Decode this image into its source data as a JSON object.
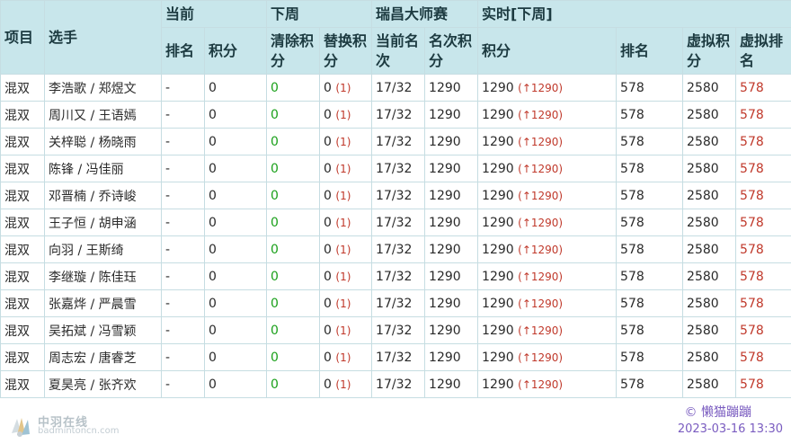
{
  "header": {
    "col_event": "项目",
    "col_players": "选手",
    "group_current": "当前",
    "group_next_week": "下周",
    "group_tournament": "瑞昌大师赛",
    "group_realtime": "实时[下周]",
    "sub_rank": "排名",
    "sub_points": "积分",
    "sub_clear_points": "清除积分",
    "sub_replace_points": "替换积分",
    "sub_current_round": "当前名次",
    "sub_round_points": "名次积分",
    "sub_rt_points": "积分",
    "sub_rt_rank": "排名",
    "sub_virtual_points": "虚拟积分",
    "sub_virtual_rank": "虚拟排名"
  },
  "rows": [
    {
      "event": "混双",
      "players": "李浩歌 / 郑煜文",
      "rank": "-",
      "points": "0",
      "clear": "0",
      "replace": "0",
      "replace_count": "(1)",
      "round": "17/32",
      "round_points": "1290",
      "rt_points": "1290",
      "rt_delta": "(↑1290)",
      "rt_rank": "578",
      "virtual_points": "2580",
      "virtual_rank": "578"
    },
    {
      "event": "混双",
      "players": "周川又 / 王语嫣",
      "rank": "-",
      "points": "0",
      "clear": "0",
      "replace": "0",
      "replace_count": "(1)",
      "round": "17/32",
      "round_points": "1290",
      "rt_points": "1290",
      "rt_delta": "(↑1290)",
      "rt_rank": "578",
      "virtual_points": "2580",
      "virtual_rank": "578"
    },
    {
      "event": "混双",
      "players": "关梓聪 / 杨晓雨",
      "rank": "-",
      "points": "0",
      "clear": "0",
      "replace": "0",
      "replace_count": "(1)",
      "round": "17/32",
      "round_points": "1290",
      "rt_points": "1290",
      "rt_delta": "(↑1290)",
      "rt_rank": "578",
      "virtual_points": "2580",
      "virtual_rank": "578"
    },
    {
      "event": "混双",
      "players": "陈锋 / 冯佳丽",
      "rank": "-",
      "points": "0",
      "clear": "0",
      "replace": "0",
      "replace_count": "(1)",
      "round": "17/32",
      "round_points": "1290",
      "rt_points": "1290",
      "rt_delta": "(↑1290)",
      "rt_rank": "578",
      "virtual_points": "2580",
      "virtual_rank": "578"
    },
    {
      "event": "混双",
      "players": "邓晋楠 / 乔诗峻",
      "rank": "-",
      "points": "0",
      "clear": "0",
      "replace": "0",
      "replace_count": "(1)",
      "round": "17/32",
      "round_points": "1290",
      "rt_points": "1290",
      "rt_delta": "(↑1290)",
      "rt_rank": "578",
      "virtual_points": "2580",
      "virtual_rank": "578"
    },
    {
      "event": "混双",
      "players": "王子恒 / 胡申涵",
      "rank": "-",
      "points": "0",
      "clear": "0",
      "replace": "0",
      "replace_count": "(1)",
      "round": "17/32",
      "round_points": "1290",
      "rt_points": "1290",
      "rt_delta": "(↑1290)",
      "rt_rank": "578",
      "virtual_points": "2580",
      "virtual_rank": "578"
    },
    {
      "event": "混双",
      "players": "向羽 / 王斯绮",
      "rank": "-",
      "points": "0",
      "clear": "0",
      "replace": "0",
      "replace_count": "(1)",
      "round": "17/32",
      "round_points": "1290",
      "rt_points": "1290",
      "rt_delta": "(↑1290)",
      "rt_rank": "578",
      "virtual_points": "2580",
      "virtual_rank": "578"
    },
    {
      "event": "混双",
      "players": "李继璇 / 陈佳珏",
      "rank": "-",
      "points": "0",
      "clear": "0",
      "replace": "0",
      "replace_count": "(1)",
      "round": "17/32",
      "round_points": "1290",
      "rt_points": "1290",
      "rt_delta": "(↑1290)",
      "rt_rank": "578",
      "virtual_points": "2580",
      "virtual_rank": "578"
    },
    {
      "event": "混双",
      "players": "张嘉烨 / 严晨雪",
      "rank": "-",
      "points": "0",
      "clear": "0",
      "replace": "0",
      "replace_count": "(1)",
      "round": "17/32",
      "round_points": "1290",
      "rt_points": "1290",
      "rt_delta": "(↑1290)",
      "rt_rank": "578",
      "virtual_points": "2580",
      "virtual_rank": "578"
    },
    {
      "event": "混双",
      "players": "吴拓斌 / 冯雪颖",
      "rank": "-",
      "points": "0",
      "clear": "0",
      "replace": "0",
      "replace_count": "(1)",
      "round": "17/32",
      "round_points": "1290",
      "rt_points": "1290",
      "rt_delta": "(↑1290)",
      "rt_rank": "578",
      "virtual_points": "2580",
      "virtual_rank": "578"
    },
    {
      "event": "混双",
      "players": "周志宏 / 唐睿芝",
      "rank": "-",
      "points": "0",
      "clear": "0",
      "replace": "0",
      "replace_count": "(1)",
      "round": "17/32",
      "round_points": "1290",
      "rt_points": "1290",
      "rt_delta": "(↑1290)",
      "rt_rank": "578",
      "virtual_points": "2580",
      "virtual_rank": "578"
    },
    {
      "event": "混双",
      "players": "夏昊亮 / 张齐欢",
      "rank": "-",
      "points": "0",
      "clear": "0",
      "replace": "0",
      "replace_count": "(1)",
      "round": "17/32",
      "round_points": "1290",
      "rt_points": "1290",
      "rt_delta": "(↑1290)",
      "rt_rank": "578",
      "virtual_points": "2580",
      "virtual_rank": "578"
    }
  ],
  "footer": {
    "logo_name": "中羽在线",
    "logo_url": "badmintoncn.com",
    "logo_icon": "shuttlecock-icon",
    "credit": "© 懒猫蹦蹦",
    "timestamp": "2023-03-16 13:30"
  },
  "colors": {
    "header_bg": "#c8e6eb",
    "grid": "#c6dde2",
    "positive_green": "#1aa01a",
    "accent_red": "#c0392b",
    "credit_purple": "#7a5cc0"
  }
}
